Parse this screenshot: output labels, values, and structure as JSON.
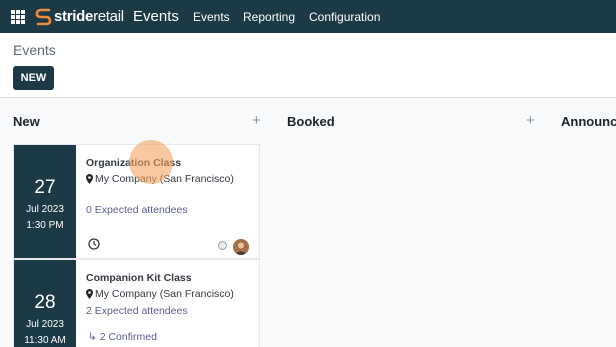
{
  "navbar": {
    "brand_prefix": "stride",
    "brand_suffix": "retail",
    "app_name": "Events",
    "menu": [
      "Events",
      "Reporting",
      "Configuration"
    ]
  },
  "control_panel": {
    "breadcrumb": "Events",
    "new_button": "NEW"
  },
  "columns": [
    {
      "title": "New",
      "add": "+"
    },
    {
      "title": "Booked",
      "add": "+"
    },
    {
      "title": "Announce"
    }
  ],
  "cards": [
    {
      "day": "27",
      "month": "Jul 2023",
      "time": "1:30 PM",
      "name": "Organization Class",
      "location": "My Company (San Francisco)",
      "attendees": "0 Expected attendees",
      "icons": [
        "clock-icon",
        "status-dot",
        "avatar"
      ]
    },
    {
      "day": "28",
      "month": "Jul 2023",
      "time": "11:30 AM",
      "name": "Companion Kit Class",
      "location": "My Company (San Francisco)",
      "attendees": "2 Expected attendees",
      "confirmed": "↳ 2 Confirmed"
    }
  ],
  "colors": {
    "navbar": "#1b3a45",
    "date_block": "#1b3a45",
    "link": "#5b5e8e",
    "ripple": "#f4a460"
  }
}
